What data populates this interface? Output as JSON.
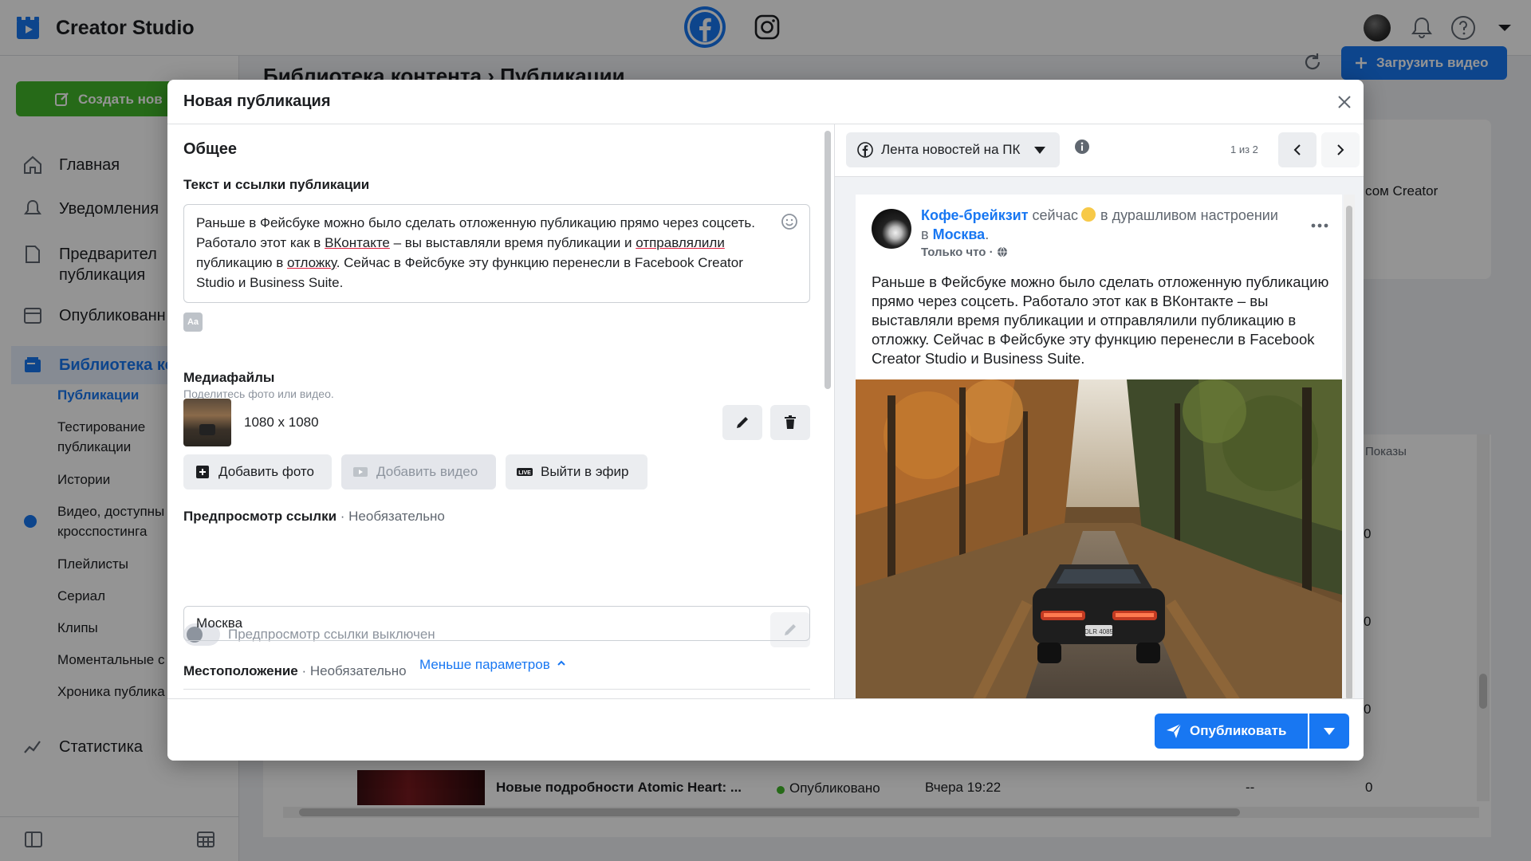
{
  "app": {
    "title": "Creator Studio"
  },
  "sidebar": {
    "create_label": "Создать нов",
    "items": [
      {
        "label": "Главная",
        "icon": "home-icon"
      },
      {
        "label": "Уведомления",
        "icon": "bell-icon"
      },
      {
        "label": "Предварител\nпубликация",
        "icon": "preview-icon"
      },
      {
        "label": "Опубликованн",
        "icon": "published-icon"
      },
      {
        "label": "Библиотека ко",
        "icon": "library-icon"
      },
      {
        "label": "Статистика",
        "icon": "stats-icon"
      }
    ],
    "subitems": [
      "Публикации",
      "Тестирование\nпубликации",
      "Истории",
      "Видео, доступны\nкросспостинга",
      "Плейлисты",
      "Сериал",
      "Клипы",
      "Моментальные с",
      "Хроника публика"
    ]
  },
  "background": {
    "breadcrumb": "Библиотека контента  ›  Публикации",
    "upload_label": "Загрузить видео",
    "card_text": "сом Creator",
    "table_col": "Показы",
    "zeros": [
      "0",
      "0",
      "0"
    ],
    "row": {
      "title": "Новые подробности Atomic Heart: ...",
      "status": "Опубликовано",
      "date": "Вчера 19:22",
      "dash": "--",
      "count": "0"
    }
  },
  "dialog": {
    "title": "Новая публикация",
    "section_general": "Общее",
    "text_label": "Текст и ссылки публикации",
    "text_parts": {
      "p1": "Раньше в Фейсбуке можно было сделать отложенную публикацию прямо через соцсеть. Работало этот как в ",
      "u1": "ВКонтакте",
      "p2": " – вы выставляли время публикации и ",
      "u2": "отправлялили",
      "p3": " публикацию в ",
      "u3": "отложку",
      "p4": ". Сейчас в Фейсбуке эту функцию перенесли в Facebook Creator Studio и Business Suite."
    },
    "font_btn": "Aa",
    "media_label": "Медиафайлы",
    "media_hint": "Поделитесь фото или видео.",
    "media_size": "1080 x 1080",
    "add_photo": "Добавить фото",
    "add_video": "Добавить видео",
    "go_live": "Выйти в эфир",
    "link_preview_label": "Предпросмотр ссылки",
    "optional": " · Необязательно",
    "link_preview_off": "Предпросмотр ссылки выключен",
    "location_label": "Местоположение",
    "location_value": "Москва",
    "less_params": "Меньше параметров",
    "publish": "Опубликовать"
  },
  "preview": {
    "feed": "Лента новостей на ПК",
    "pager": "1 из 2",
    "page_name": "Кофе-брейкзит",
    "when": " сейчас",
    "mood": "в дурашливом настроении",
    "in_word": "в ",
    "city": "Москва",
    "time": "Только что ·",
    "text": "Раньше в Фейсбуке можно было сделать отложенную публикацию прямо через соцсеть. Работало этот как в ВКонтакте – вы выставляли время публикации и отправлялили публикацию в отложку. Сейчас в Фейсбуке эту функцию перенесли в Facebook Creator Studio и Business Suite.",
    "plate": "DLR 4085"
  },
  "colors": {
    "accent": "#1877f2",
    "create": "#42b72a",
    "text": "#1c1e21",
    "muted": "#606770"
  }
}
